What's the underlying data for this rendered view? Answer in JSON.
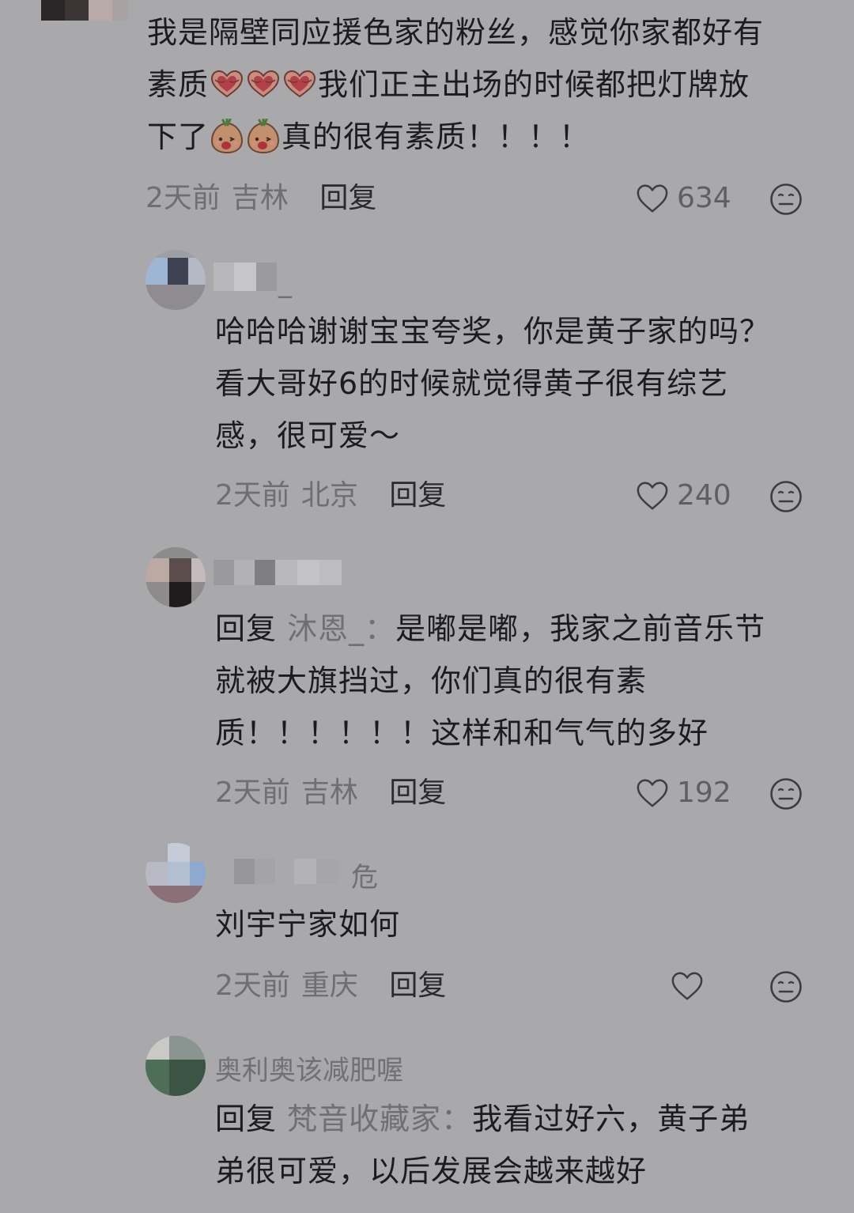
{
  "comments": [
    {
      "lines": [
        "我是隔壁同应援色家的粉丝，感觉你家都好有",
        "素质",
        "我们正主出场的时候都把灯牌放",
        "下了",
        "真的很有素质！！！！"
      ],
      "time": "2天前",
      "location": "吉林",
      "reply_label": "回复",
      "likes": "634"
    },
    {
      "username_tail": "_",
      "lines": [
        "哈哈哈谢谢宝宝夸奖，你是黄子家的吗？",
        "看大哥好6的时候就觉得黄子很有综艺",
        "感，很可爱～"
      ],
      "time": "2天前",
      "location": "北京",
      "reply_label": "回复",
      "likes": "240"
    },
    {
      "reply_prefix": "回复",
      "reply_target": "沐恩_：",
      "lines": [
        "是嘟是嘟，我家之前音乐节",
        "就被大旗挡过，你们真的很有素",
        "质！！！！！！这样和和气气的多好"
      ],
      "time": "2天前",
      "location": "吉林",
      "reply_label": "回复",
      "likes": "192"
    },
    {
      "username_tail": "危",
      "lines": [
        "刘宇宁家如何"
      ],
      "time": "2天前",
      "location": "重庆",
      "reply_label": "回复",
      "likes": ""
    },
    {
      "username": "奥利奥该减肥喔",
      "reply_prefix": "回复",
      "reply_target": "梵音收藏家：",
      "lines": [
        "我看过好六，黄子弟",
        "弟很可爱，以后发展会越来越好"
      ]
    }
  ],
  "icons": {
    "like": "heart-outline-icon",
    "dislike": "meh-face-icon",
    "emoji1": "heart-hands-emoji",
    "emoji2": "shy-potato-emoji"
  }
}
